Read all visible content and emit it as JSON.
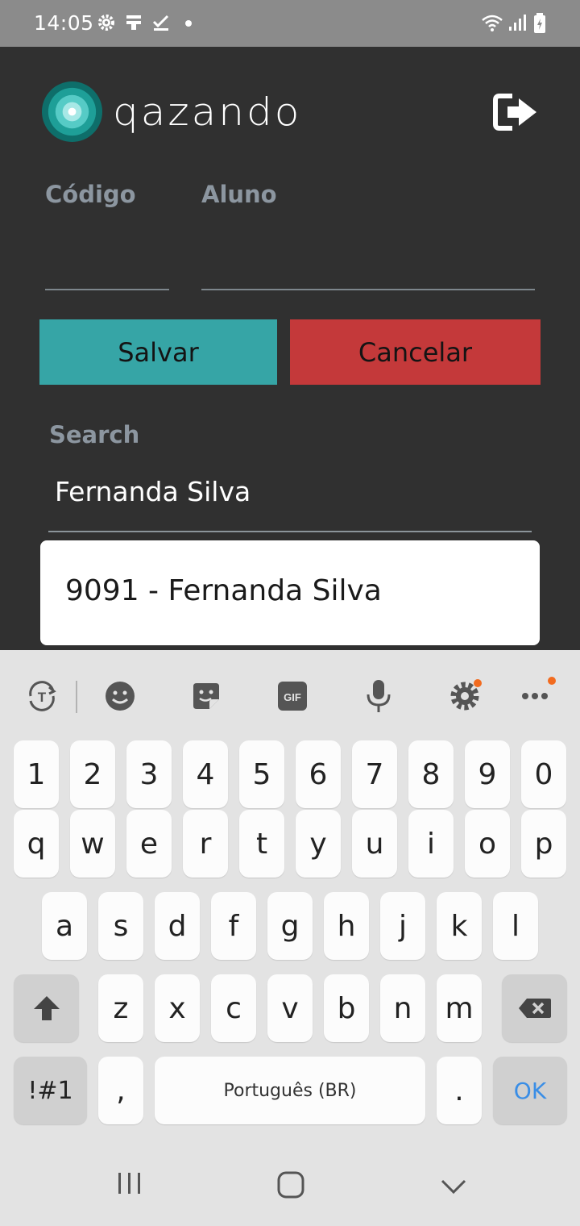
{
  "status_bar": {
    "time": "14:05"
  },
  "header": {
    "brand": "qazando"
  },
  "form": {
    "codigo_label": "Código",
    "aluno_label": "Aluno",
    "codigo_value": "",
    "aluno_value": "",
    "save_label": "Salvar",
    "cancel_label": "Cancelar",
    "search_label": "Search",
    "search_value": "Fernanda Silva",
    "suggestion": "9091 - Fernanda Silva"
  },
  "colors": {
    "accent": "#36a5a6",
    "danger": "#c4393a",
    "background": "#303030"
  },
  "keyboard": {
    "toolbar_icons": [
      "translate-icon",
      "emoji-icon",
      "sticker-icon",
      "gif-icon",
      "microphone-icon",
      "settings-icon",
      "more-icon"
    ],
    "gif_label": "GIF",
    "row_numbers": [
      "1",
      "2",
      "3",
      "4",
      "5",
      "6",
      "7",
      "8",
      "9",
      "0"
    ],
    "row_top": [
      "q",
      "w",
      "e",
      "r",
      "t",
      "y",
      "u",
      "i",
      "o",
      "p"
    ],
    "row_middle": [
      "a",
      "s",
      "d",
      "f",
      "g",
      "h",
      "j",
      "k",
      "l"
    ],
    "row_bottom": [
      "z",
      "x",
      "c",
      "v",
      "b",
      "n",
      "m"
    ],
    "symbols_label": "!#1",
    "comma": ",",
    "space_label": "Português (BR)",
    "period": ".",
    "ok_label": "OK"
  }
}
